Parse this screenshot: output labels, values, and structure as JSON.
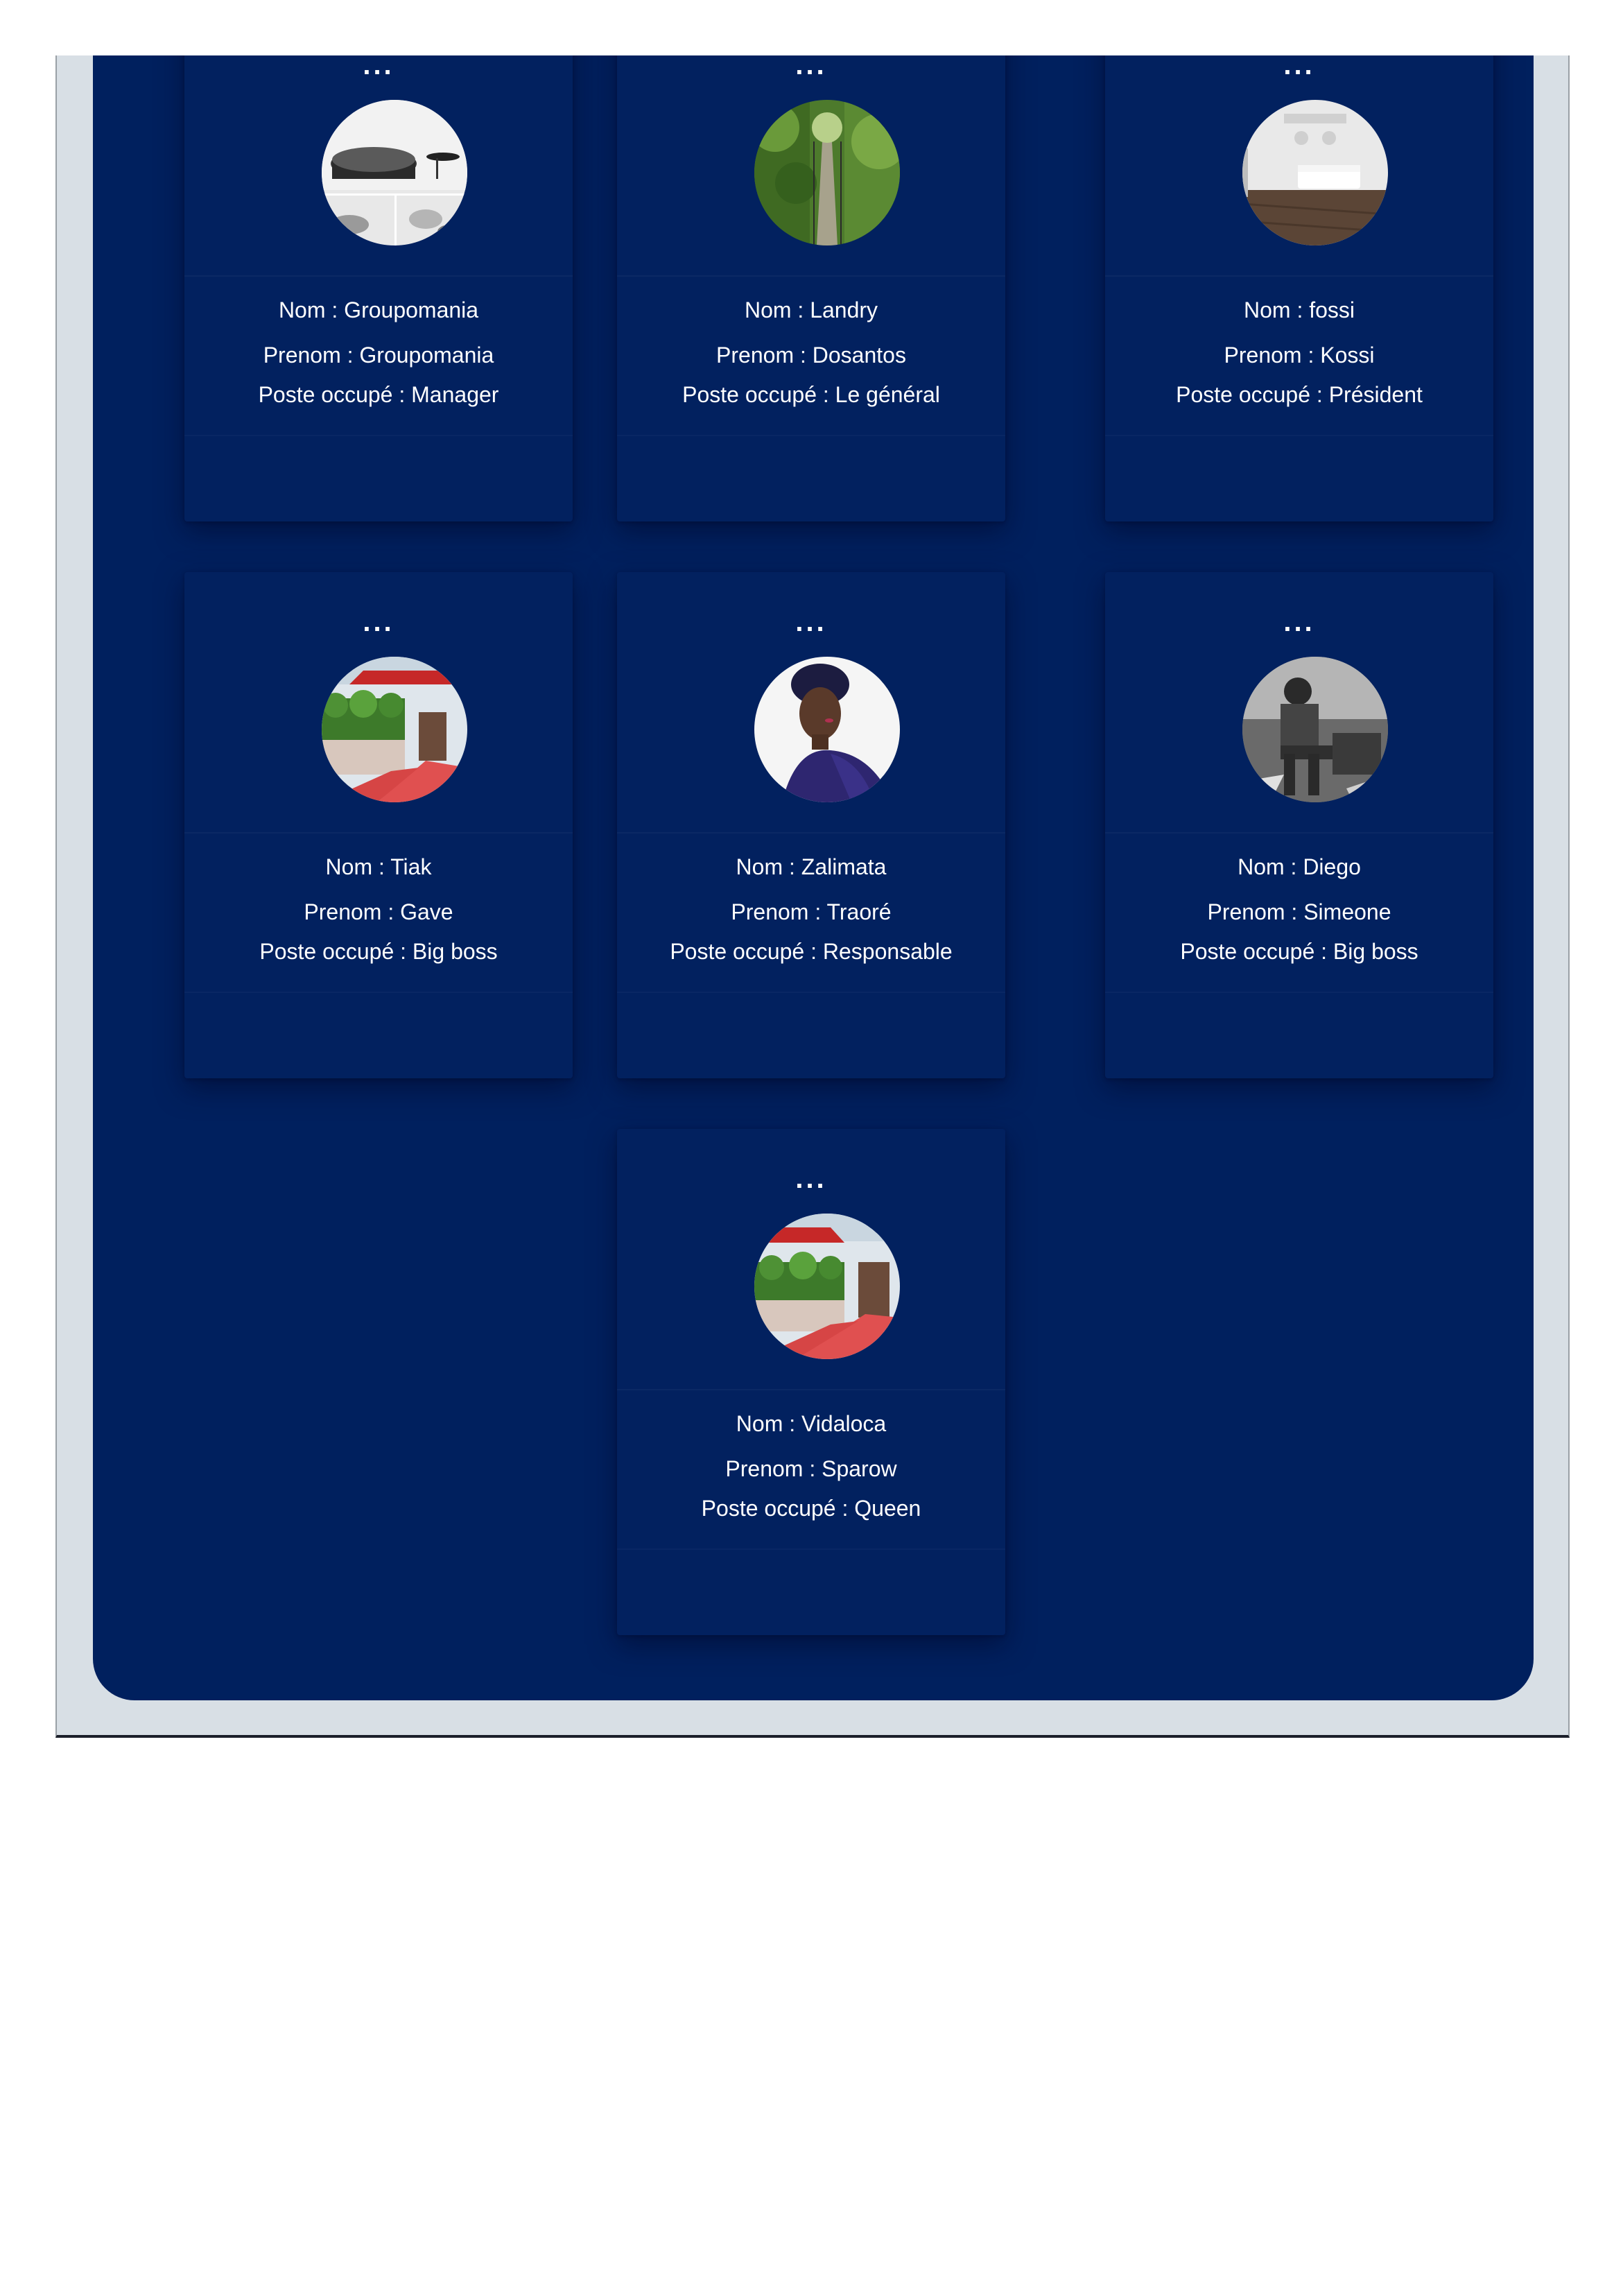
{
  "colors": {
    "background": "#ffffff",
    "viewport": "#d8dfe5",
    "panel": "#00205e",
    "card": "#02215f",
    "text": "#ffffff"
  },
  "cards": [
    {
      "menu": "...",
      "avatar": "avatar-photo",
      "nom": "Nom : Groupomania",
      "prenom": "Prenom : Groupomania",
      "poste": "Poste occupé : Manager"
    },
    {
      "menu": "...",
      "avatar": "avatar-photo",
      "nom": "Nom : Landry",
      "prenom": "Prenom : Dosantos",
      "poste": "Poste occupé : Le général"
    },
    {
      "menu": "...",
      "avatar": "avatar-photo",
      "nom": "Nom : fossi",
      "prenom": "Prenom : Kossi",
      "poste": "Poste occupé : Président"
    },
    {
      "menu": "...",
      "avatar": "avatar-photo",
      "nom": "Nom : Tiak",
      "prenom": "Prenom : Gave",
      "poste": "Poste occupé : Big boss"
    },
    {
      "menu": "...",
      "avatar": "avatar-photo",
      "nom": "Nom : Zalimata",
      "prenom": "Prenom : Traoré",
      "poste": "Poste occupé : Responsable"
    },
    {
      "menu": "...",
      "avatar": "avatar-photo",
      "nom": "Nom : Diego",
      "prenom": "Prenom : Simeone",
      "poste": "Poste occupé : Big boss"
    },
    {
      "menu": "...",
      "avatar": "avatar-photo",
      "nom": "Nom : Vidaloca",
      "prenom": "Prenom : Sparow",
      "poste": "Poste occupé : Queen"
    }
  ]
}
